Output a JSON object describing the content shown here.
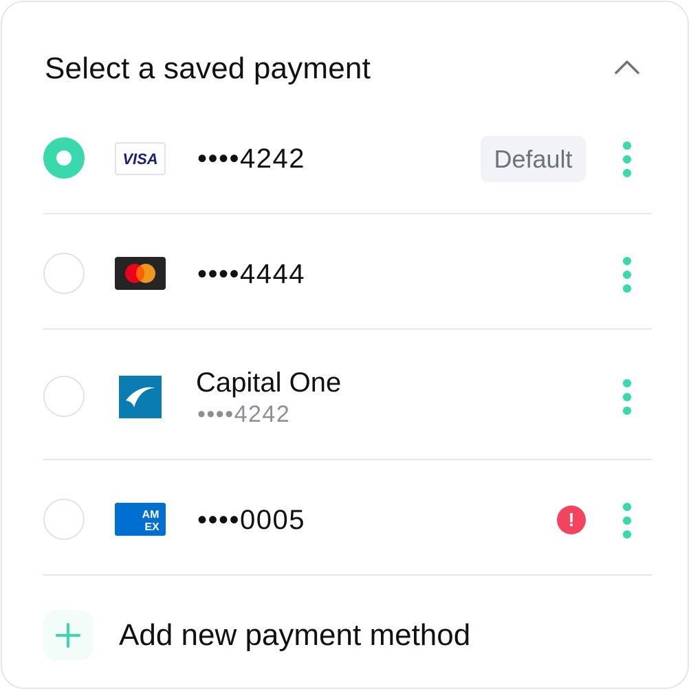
{
  "header": {
    "title": "Select a saved payment",
    "collapse_icon": "chevron-up-icon"
  },
  "colors": {
    "accent": "#3ad8ad",
    "alert": "#f2445e",
    "divider": "#e3e6ea",
    "badge_bg": "#f1f3f6"
  },
  "payments": [
    {
      "brand": "visa",
      "brand_label": "VISA",
      "masked": "••••4242",
      "selected": true,
      "badge": "Default"
    },
    {
      "brand": "mastercard",
      "masked": "••••4444",
      "selected": false
    },
    {
      "brand": "capital-one",
      "name": "Capital One",
      "masked": "••••4242",
      "selected": false
    },
    {
      "brand": "amex",
      "brand_label": "AMEX",
      "masked": "••••0005",
      "selected": false,
      "alert": "!"
    }
  ],
  "add": {
    "label": "Add new payment method",
    "icon": "plus-icon"
  }
}
